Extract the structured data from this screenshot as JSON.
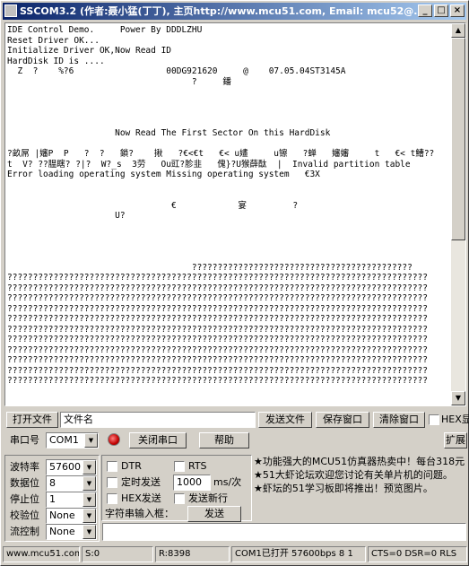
{
  "window": {
    "title": "SSCOM3.2 (作者:聂小猛(丁丁), 主页http://www.mcu51.com, Email: mcu52@...",
    "minimize": "_",
    "maximize": "□",
    "close": "×"
  },
  "console_text": "IDE Control Demo.     Power By DDDLZHU\nReset Driver OK...\nInitialize Driver OK,Now Read ID\nHardDisk ID is ....\n  Z  ?    %?6                  00DG921620     @    07.05.04ST3145A\n                                    ?     鐇\n\n\n\n\n                     Now Read The First Sector On this HardDisk\n\n?畝屌 |嬸P  P   ?  ?   鎖?    揪   ?€<€t   €< u嫿     u镲   ?蝉   嬸嬸     t   €< t鰽??\nt  V? ??腽瞎? ?|?  W?_s  3劳   Ou豇?胗韭   傀}?U猴薛酞  |  Invalid partition table\nError loading operating system Missing operating system   €3X\n\n\n                                €            宴         ?\n                     U?\n\n\n\n\n                                    ???????????????????????????????????????????\n??????????????????????????????????????????????????????????????????????????????????\n??????????????????????????????????????????????????????????????????????????????????\n??????????????????????????????????????????????????????????????????????????????????\n??????????????????????????????????????????????????????????????????????????????????\n??????????????????????????????????????????????????????????????????????????????????\n??????????????????????????????????????????????????????????????????????????????????\n??????????????????????????????????????????????????????????????????????????????????\n??????????????????????????????????????????????????????????????????????????????????\n??????????????????????????????????????????????????????????????????????????????????\n??????????????????????????????????????????????????????????????????????????????????\n??????????????????????????????????????????????????????????????????????????????????",
  "toolbar": {
    "open_file": "打开文件",
    "filename_value": "文件名",
    "send_file": "发送文件",
    "save_window": "保存窗口",
    "clear_window": "清除窗口",
    "hex_display": "HEX显",
    "port_label": "串口号",
    "port_value": "COM1",
    "close_port": "关闭串口",
    "help": "帮助",
    "expand": "扩展"
  },
  "settings": {
    "baud_label": "波特率",
    "baud_value": "57600",
    "databits_label": "数据位",
    "databits_value": "8",
    "stopbits_label": "停止位",
    "stopbits_value": "1",
    "parity_label": "校验位",
    "parity_value": "None",
    "flow_label": "流控制",
    "flow_value": "None"
  },
  "send": {
    "dtr": "DTR",
    "rts": "RTS",
    "timed_send": "定时发送",
    "interval_value": "1000",
    "interval_unit": "ms/次",
    "hex_send": "HEX发送",
    "send_newline": "发送新行",
    "input_label": "字符串输入框：",
    "send_button": "发送"
  },
  "info": [
    "★功能强大的MCU51仿真器热卖中！每台318元",
    "★51大虾论坛欢迎您讨论有关单片机的问题。",
    "★虾坛的51学习板即将推出！预览图片。"
  ],
  "status": {
    "site": "www.mcu51.com",
    "sent": "S:0",
    "received": "R:8398",
    "port_state": "COM1已打开  57600bps  8 1",
    "lines": "CTS=0 DSR=0 RLS"
  }
}
